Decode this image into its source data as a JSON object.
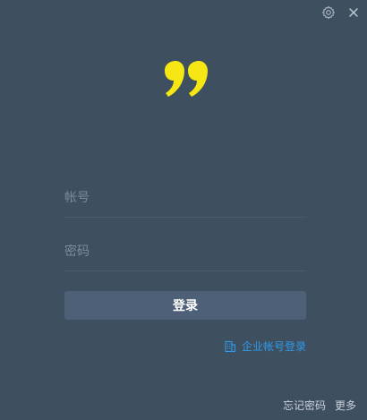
{
  "window": {
    "background": "#3e4f60",
    "controls": {
      "settings_icon": "gear-icon",
      "close_icon": "close-icon"
    }
  },
  "logo": {
    "icon": "quote-icon",
    "color": "#f5e614"
  },
  "form": {
    "account": {
      "placeholder": "帐号",
      "value": ""
    },
    "password": {
      "placeholder": "密码",
      "value": ""
    },
    "login_label": "登录",
    "login_color": "#4d6078"
  },
  "enterprise": {
    "label": "企业帐号登录",
    "icon": "building-icon",
    "color": "#2f9be8"
  },
  "footer": {
    "forgot_password": "忘记密码",
    "more": "更多"
  }
}
